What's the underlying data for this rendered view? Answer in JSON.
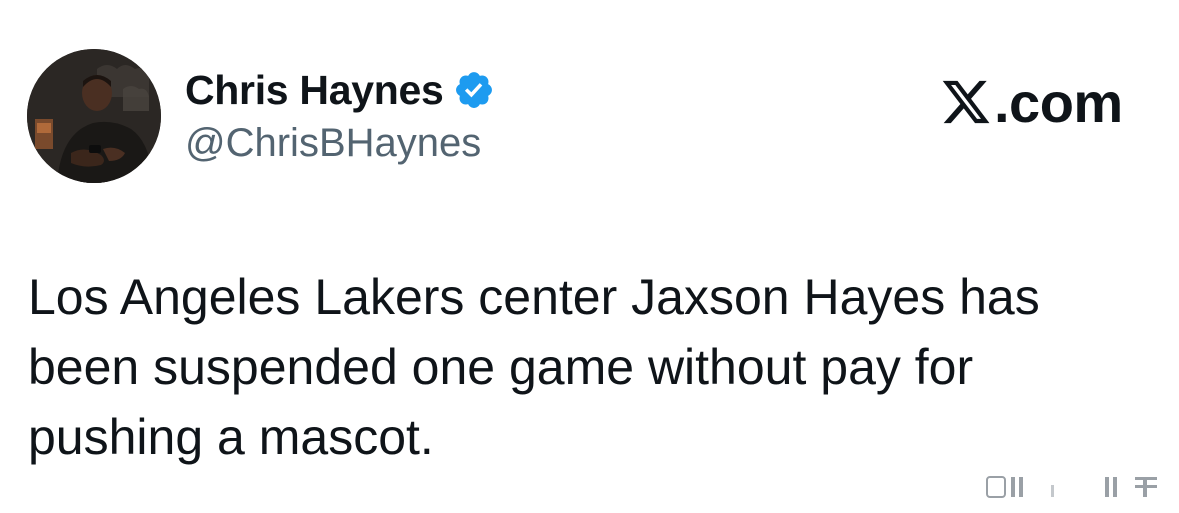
{
  "tweet": {
    "author": {
      "name": "Chris Haynes",
      "handle": "@ChrisBHaynes",
      "verified": true,
      "avatar_icon": "profile-photo"
    },
    "text": "Los Angeles Lakers center Jaxson Hayes has been suspended one game without pay for pushing a mascot."
  },
  "brand": {
    "label": ".com",
    "logo_icon": "x-logo-icon"
  },
  "colors": {
    "text_primary": "#0f1419",
    "text_secondary": "#536471",
    "verified_blue": "#1d9bf0",
    "background": "#ffffff"
  }
}
